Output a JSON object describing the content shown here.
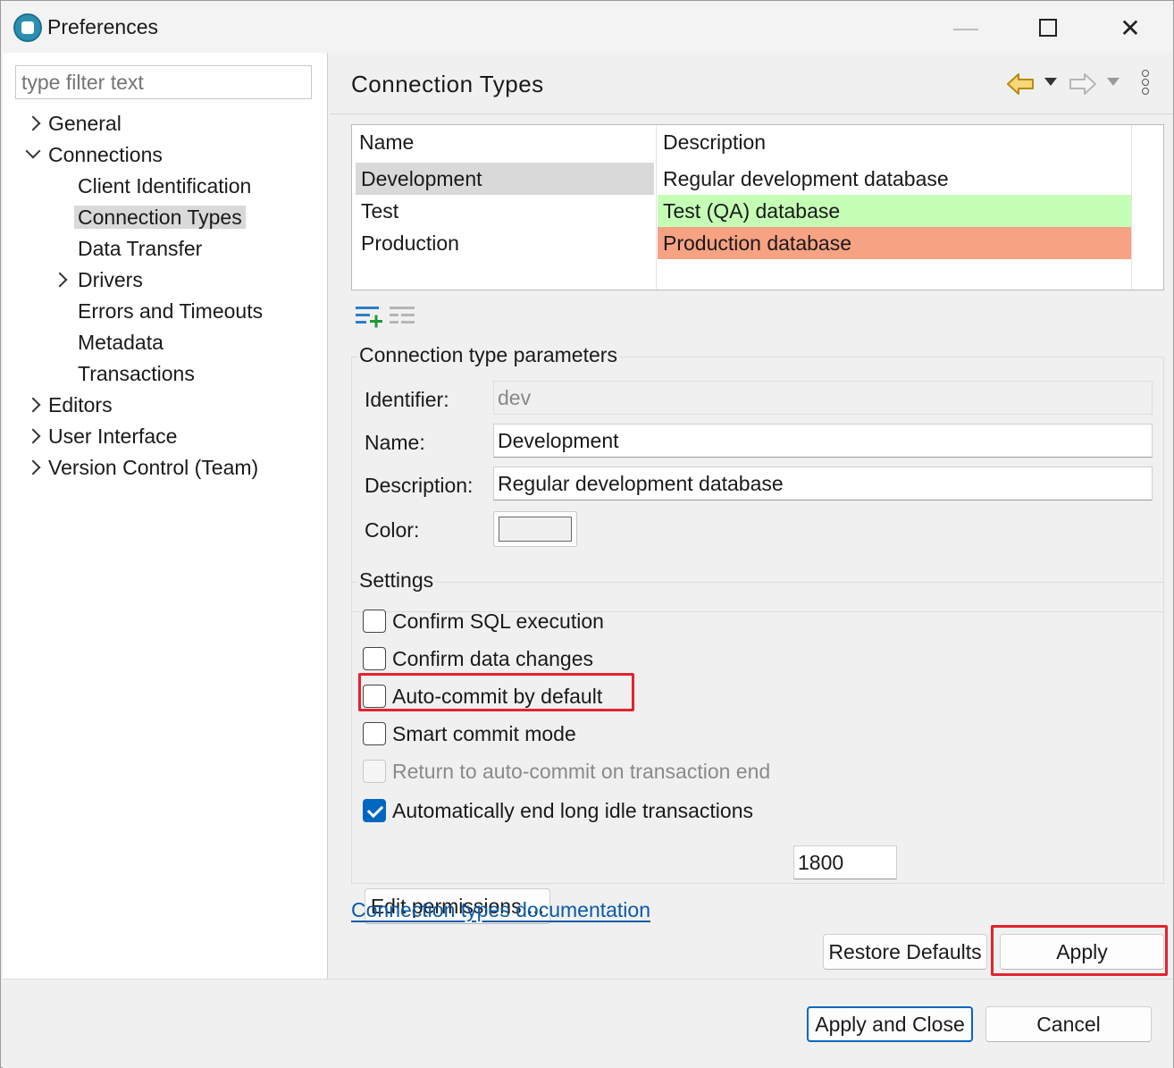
{
  "window": {
    "title": "Preferences",
    "close_glyph": "✕",
    "minimize_glyph": "—"
  },
  "filter": {
    "placeholder": "type filter text"
  },
  "tree": {
    "general": "General",
    "connections": "Connections",
    "client_identification": "Client Identification",
    "connection_types": "Connection Types",
    "data_transfer": "Data Transfer",
    "drivers": "Drivers",
    "errors_timeouts": "Errors and Timeouts",
    "metadata": "Metadata",
    "transactions": "Transactions",
    "editors": "Editors",
    "user_interface": "User Interface",
    "version_control": "Version Control (Team)"
  },
  "page": {
    "title": "Connection Types"
  },
  "table": {
    "headers": {
      "name": "Name",
      "description": "Description"
    },
    "rows": [
      {
        "name": "Development",
        "description": "Regular development database",
        "color": "#ffffff"
      },
      {
        "name": "Test",
        "description": "Test (QA) database",
        "color": "#c4ffb5"
      },
      {
        "name": "Production",
        "description": "Production database",
        "color": "#f7a283"
      }
    ]
  },
  "params": {
    "title": "Connection type parameters",
    "identifier_label": "Identifier:",
    "identifier_value": "dev",
    "name_label": "Name:",
    "name_value": "Development",
    "description_label": "Description:",
    "description_value": "Regular development database",
    "color_label": "Color:"
  },
  "settings": {
    "title": "Settings",
    "confirm_sql": "Confirm SQL execution",
    "confirm_data": "Confirm data changes",
    "auto_commit": "Auto-commit by default",
    "smart_commit": "Smart commit mode",
    "return_auto_commit": "Return to auto-commit on transaction end",
    "auto_end_idle": "Automatically end long idle transactions",
    "idle_timeout": "1800",
    "edit_permissions": "Edit permissions ..."
  },
  "link": {
    "documentation": "Connection types documentation"
  },
  "buttons": {
    "restore_defaults": "Restore Defaults",
    "apply": "Apply",
    "apply_close": "Apply and Close",
    "cancel": "Cancel"
  },
  "colors": {
    "accent": "#0067c0",
    "highlight": "#e3232e",
    "link": "#0a5aa8"
  }
}
